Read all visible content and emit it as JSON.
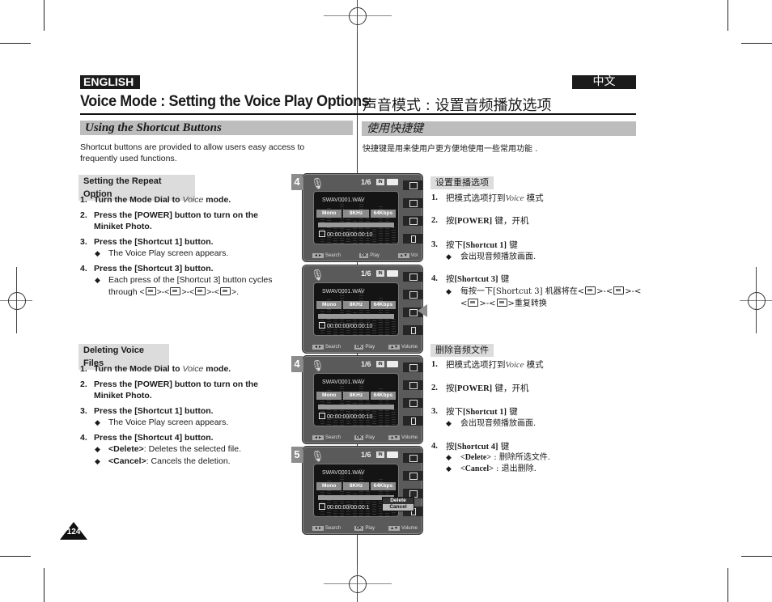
{
  "header": {
    "lang_en": "ENGLISH",
    "lang_zh": "中文",
    "title_en": "Voice Mode : Setting the Voice Play Options",
    "title_zh": "声音模式 : 设置音频播放选项"
  },
  "section": {
    "title_en": "Using the Shortcut Buttons",
    "title_zh": "使用快捷键",
    "intro_en_line1": "Shortcut buttons are provided to allow users easy access to",
    "intro_en_line2": "frequently used functions.",
    "intro_zh": "快捷键是用来使用户更方便地使用一些常用功能 ."
  },
  "repeat_en": {
    "heading": "Setting the Repeat Option",
    "steps": [
      {
        "n": "1.",
        "pre": "Turn the Mode Dial to ",
        "voice": "Voice",
        "post": " mode."
      },
      {
        "n": "2.",
        "line1": "Press the [POWER] button to turn on the",
        "line2": "Miniket Photo."
      },
      {
        "n": "3.",
        "text": "Press the [Shortcut 1] button."
      },
      {
        "n": "4.",
        "text": "Press the [Shortcut 3] button."
      }
    ],
    "bullet3": "The Voice Play screen appears.",
    "bullet4_line1": "Each press of the [Shortcut 3] button cycles",
    "bullet4_pre": "through <",
    "bullet4_sep": ">-<",
    "bullet4_end": ">."
  },
  "delete_en": {
    "heading": "Deleting Voice Files",
    "steps": [
      {
        "n": "1.",
        "pre": "Turn the Mode Dial to ",
        "voice": "Voice",
        "post": " mode."
      },
      {
        "n": "2.",
        "line1": "Press the [POWER] button to turn on the",
        "line2": "Miniket Photo."
      },
      {
        "n": "3.",
        "text": "Press the [Shortcut 1] button."
      },
      {
        "n": "4.",
        "text": "Press the [Shortcut 4] button."
      }
    ],
    "bullet3": "The Voice Play screen appears.",
    "bullet4a_key": "<Delete>",
    "bullet4a_text": ": Deletes the selected file.",
    "bullet4b_key": "<Cancel>",
    "bullet4b_text": ": Cancels the deletion."
  },
  "repeat_zh": {
    "heading": "设置重播选项",
    "s1_pre": "把模式选项打到",
    "s1_voice": "Voice",
    "s1_post": "模式",
    "s2_pre": "按",
    "s2_key": "[POWER]",
    "s2_post": "键，开机",
    "s3_pre": "按下",
    "s3_key": "[Shortcut 1]",
    "s3_post": "键",
    "s3_bullet": "会出现音频播放画面.",
    "s4_pre": "按",
    "s4_key": "[Shortcut 3]",
    "s4_post": "键",
    "s4_bullet_line1_pre": "每按一下[Shortcut 3] 机器将在<",
    "s4_bullet_sep": ">-<",
    "s4_bullet_line2_pre": "<",
    "s4_bullet_end": ">重复转换"
  },
  "delete_zh": {
    "heading": "删除音频文件",
    "s1_pre": "把模式选项打到",
    "s1_voice": "Voice",
    "s1_post": "模式",
    "s2_pre": "按",
    "s2_key": "[POWER]",
    "s2_post": "键，开机",
    "s3_pre": "按下",
    "s3_key": "[Shortcut 1]",
    "s3_post": "键",
    "s3_bullet": "会出现音频播放画面.",
    "s4_pre": "按",
    "s4_key": "[Shortcut 4]",
    "s4_post": "键",
    "b_delete_key": "<Delete>",
    "b_delete_text": " : 删除所选文件.",
    "b_cancel_key": "<Cancel>",
    "b_cancel_text": " : 退出删除."
  },
  "screens": [
    {
      "step": "4",
      "counter": "1/6",
      "memory": "IN",
      "file": "SWAV0001.WAV",
      "tags": [
        "Mono",
        "8KHz",
        "64Kbps"
      ],
      "timecode": "00:00:00/00:00:10",
      "footer": [
        "Search",
        "Play",
        "Vol"
      ],
      "keys": [
        "◄►",
        "OK",
        "▲▼"
      ]
    },
    {
      "step": "",
      "counter": "1/6",
      "memory": "IN",
      "file": "SWAV0001.WAV",
      "tags": [
        "Mono",
        "8KHz",
        "64Kbps"
      ],
      "timecode": "00:00:00/00:00:10",
      "footer": [
        "Search",
        "Play",
        "Volume"
      ],
      "keys": [
        "◄►",
        "OK",
        "▲▼"
      ]
    },
    {
      "step": "4",
      "counter": "1/6",
      "memory": "IN",
      "file": "SWAV0001.WAV",
      "tags": [
        "Mono",
        "8KHz",
        "64Kbps"
      ],
      "timecode": "00:00:00/00:00:10",
      "footer": [
        "Search",
        "Play",
        "Volume"
      ],
      "keys": [
        "◄►",
        "OK",
        "▲▼"
      ]
    },
    {
      "step": "5",
      "counter": "1/6",
      "memory": "IN",
      "file": "SWAV0001.WAV",
      "tags": [
        "Mono",
        "8KHz",
        "64Kbps"
      ],
      "timecode": "00:00:00/00:00:1",
      "footer": [
        "Search",
        "Play",
        "Volume"
      ],
      "keys": [
        "◄►",
        "OK",
        "▲▼"
      ],
      "popup": [
        "Delete",
        "Cancel"
      ]
    }
  ],
  "page_number": "124"
}
